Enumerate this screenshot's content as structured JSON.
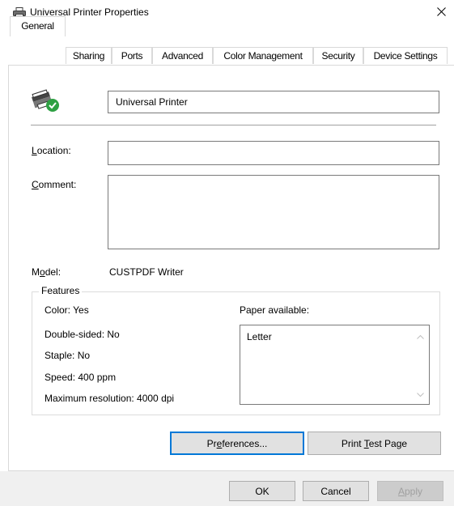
{
  "window": {
    "title": "Universal Printer Properties",
    "close_glyph": "✕",
    "icon": "printer-icon"
  },
  "tabs": [
    {
      "label": "General",
      "active": true
    },
    {
      "label": "Sharing",
      "active": false
    },
    {
      "label": "Ports",
      "active": false
    },
    {
      "label": "Advanced",
      "active": false
    },
    {
      "label": "Color Management",
      "active": false
    },
    {
      "label": "Security",
      "active": false
    },
    {
      "label": "Device Settings",
      "active": false
    }
  ],
  "general": {
    "printer_icon": "printer-ready-icon",
    "printer_name": "Universal Printer",
    "location_label_prefix": "",
    "location_label_accel": "L",
    "location_label_rest": "ocation:",
    "location_value": "",
    "comment_label_accel": "C",
    "comment_label_rest": "omment:",
    "comment_value": "",
    "model_label_pre": "M",
    "model_label_accel": "o",
    "model_label_rest": "del:",
    "model_value": "CUSTPDF Writer"
  },
  "features": {
    "legend": "Features",
    "color": "Color: Yes",
    "double_sided": "Double-sided: No",
    "staple": "Staple: No",
    "speed": "Speed: 400 ppm",
    "max_resolution": "Maximum resolution: 4000 dpi",
    "paper_label": "Paper available:",
    "paper_options": [
      "Letter"
    ]
  },
  "buttons": {
    "preferences_pre": "Pr",
    "preferences_accel": "e",
    "preferences_rest": "ferences...",
    "print_test_pre": "Print ",
    "print_test_accel": "T",
    "print_test_rest": "est Page",
    "ok": "OK",
    "cancel": "Cancel",
    "apply_accel": "A",
    "apply_rest": "pply"
  },
  "colors": {
    "focus_border": "#0078d7",
    "status_ok_green": "#2ea043"
  }
}
